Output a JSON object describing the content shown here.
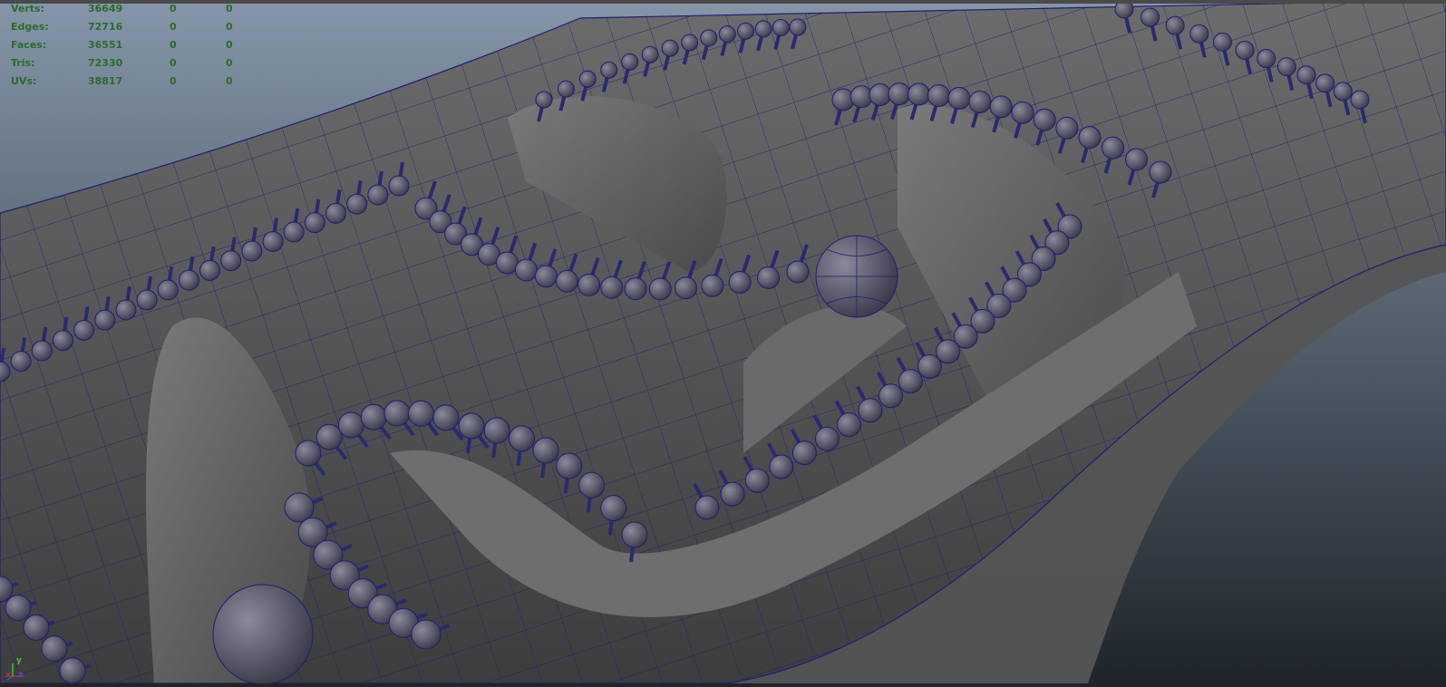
{
  "poly_count": {
    "rows": [
      {
        "label": "Verts:",
        "v1": "36649",
        "v2": "0",
        "v3": "0"
      },
      {
        "label": "Edges:",
        "v1": "72716",
        "v2": "0",
        "v3": "0"
      },
      {
        "label": "Faces:",
        "v1": "36551",
        "v2": "0",
        "v3": "0"
      },
      {
        "label": "Tris:",
        "v1": "72330",
        "v2": "0",
        "v3": "0"
      },
      {
        "label": "UVs:",
        "v1": "38817",
        "v2": "0",
        "v3": "0"
      }
    ]
  },
  "axis_indicator": {
    "x": "x",
    "y": "y",
    "z": "z",
    "x_color": "#d22b2b",
    "y_color": "#3fbf3f",
    "z_color": "#3b5bd6"
  },
  "colors": {
    "background_top": "#7c8ea0",
    "background_bottom": "#1f242b",
    "mesh_surface": "#5e5e5e",
    "wireframe": "#1a1a7a",
    "hud_text": "#2c6b2a"
  }
}
